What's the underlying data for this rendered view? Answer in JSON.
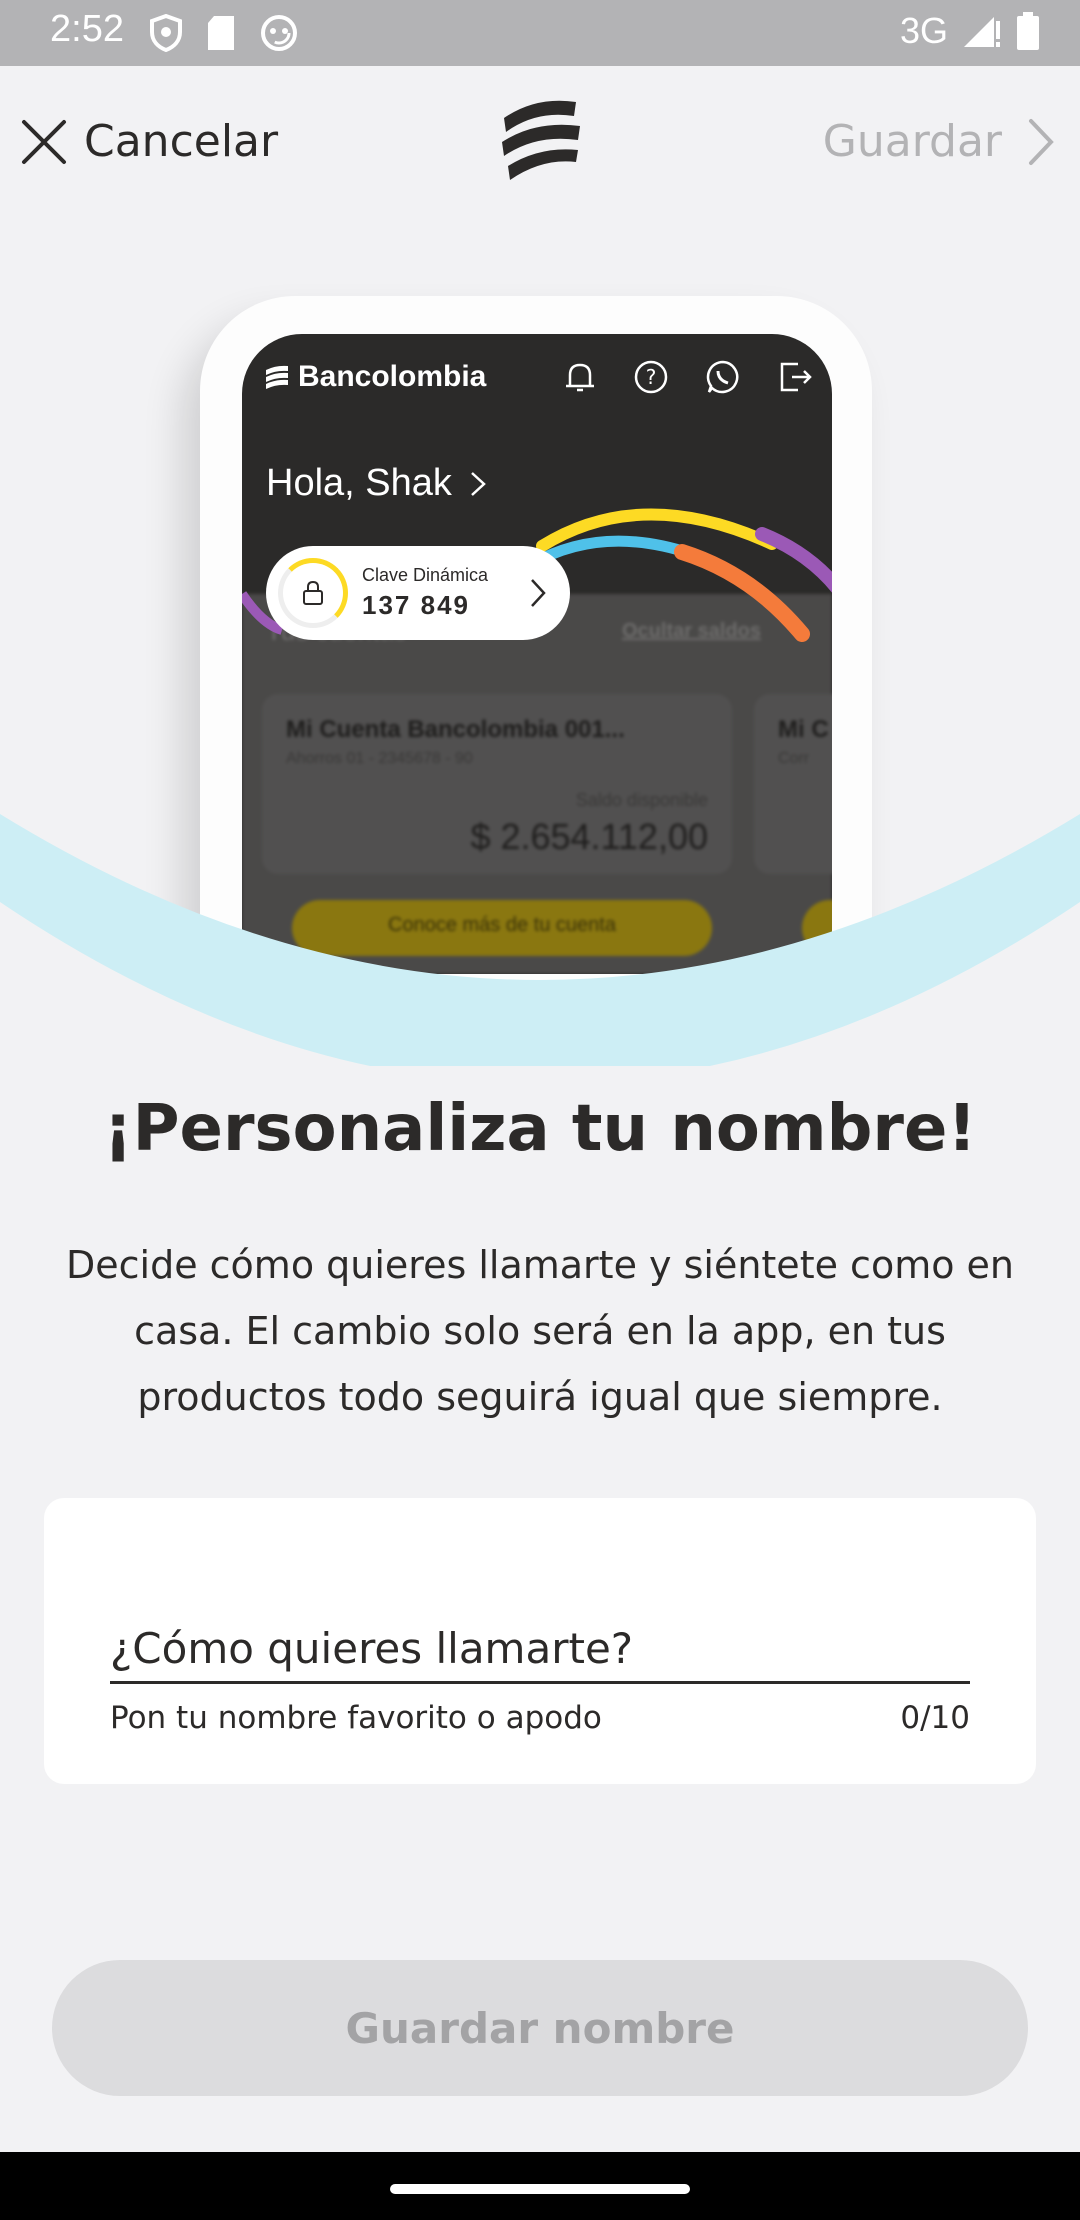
{
  "status_bar": {
    "time": "2:52",
    "network": "3G",
    "icons": [
      "shield-icon",
      "sd-card-icon",
      "face-icon",
      "signal-icon",
      "battery-icon"
    ]
  },
  "header": {
    "cancel_label": "Cancelar",
    "save_label": "Guardar"
  },
  "hero": {
    "brand": "Bancolombia",
    "greeting": "Hola, Shak",
    "clave_label": "Clave Dinámica",
    "clave_code": "137  849",
    "accounts_label": "Tus cuentas",
    "hide_balances": "Ocultar saldos",
    "account_name": "Mi Cuenta Bancolombia 001...",
    "account_sub": "Ahorros 01 - 2345678 - 90",
    "account_name_2": "Mi C",
    "account_sub_2": "Corr",
    "balance_label": "Saldo disponible",
    "balance": "$ 2.654.112,00",
    "account_cta": "Conoce más de tu cuenta"
  },
  "content": {
    "title": "¡Personaliza tu nombre!",
    "description": "Decide cómo quieres llamarte y siéntete como en casa. El cambio solo será en la app, en tus productos todo seguirá igual que siempre."
  },
  "form": {
    "name_placeholder": "¿Cómo quieres llamarte?",
    "name_value": "",
    "helper": "Pon tu nombre favorito o apodo",
    "counter": "0/10"
  },
  "actions": {
    "save_name_label": "Guardar nombre"
  },
  "colors": {
    "brand_yellow": "#fdda24",
    "wave_blue": "#cdeef5",
    "text_dark": "#2c2a29",
    "disabled_gray": "#b3b3b5"
  }
}
